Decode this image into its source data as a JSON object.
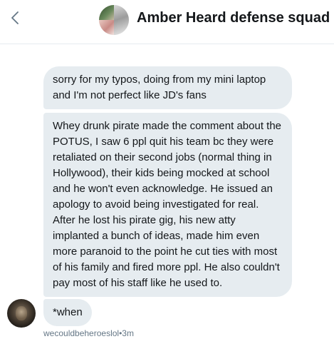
{
  "header": {
    "back_icon": "chevron-left-icon",
    "group_avatar_icon": "group-avatar-collage",
    "title": "Amber Heard defense squad"
  },
  "messages": [
    {
      "text": "sorry for my typos, doing from my mini laptop and I'm not perfect like JD's fans"
    },
    {
      "text": "Whey drunk pirate made the comment about the POTUS, I saw 6 ppl quit his team bc they were retaliated on their second jobs (normal thing in Hollywood), their kids being mocked at school and he won't even acknowledge. He issued an apology to avoid being investigated for real. After he lost his pirate gig, his new atty implanted a bunch of ideas, made him even more paranoid to the point he cut ties with most of his family and fired more ppl. He also couldn't pay most of his staff like he used to."
    },
    {
      "text": "*when"
    }
  ],
  "footer": {
    "username": "wecouldbeheroeslol",
    "separator": "•",
    "time": "3m"
  },
  "colors": {
    "bubble_bg": "#e6ecf0",
    "text": "#14171a",
    "meta": "#657786"
  }
}
